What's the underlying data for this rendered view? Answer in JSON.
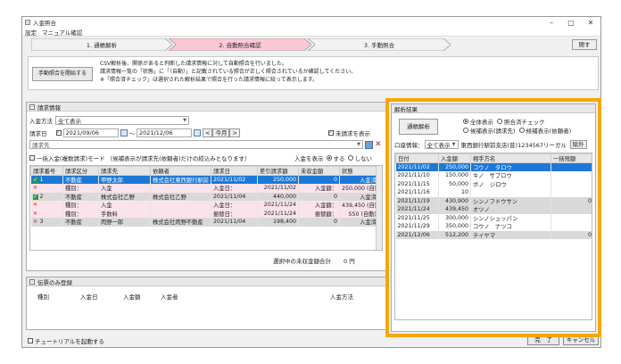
{
  "window": {
    "title": "入金照合",
    "controls": [
      "–",
      "▢",
      "✕"
    ]
  },
  "menu": [
    "設定",
    "マニュアル確認"
  ],
  "steps": [
    {
      "label": "1. 通帳解析",
      "color": "#f2f2f2"
    },
    {
      "label": "2. 自動照合確認",
      "color": "#f9c9d6"
    },
    {
      "label": "3. 手動照合",
      "color": "#f2f2f2"
    }
  ],
  "back_button": "閉す",
  "info": {
    "start_button": "手動照合を開始する",
    "lines": [
      "CSV解析後、関係があると判断した請求情報に対して自動照合を行いました。",
      "請求情報一覧の「状態」に「（自動）」と記載されている照合が正しく照合されているか確認してください。",
      "※「照合済チェック」は選択された解析結果で照合を行った請求情報に絞って表示します。"
    ]
  },
  "billing": {
    "header": "請求情報",
    "method_label": "入金方法",
    "method_value": "全て表示",
    "date_label": "請求日",
    "date_from": "2021/09/06",
    "date_to": "2021/12/06",
    "prev_btn": "<",
    "month_btn": "今月",
    "next_btn": ">",
    "unbilled_label": "未請求を表示",
    "client_placeholder": "請求先",
    "bulk_label": "一括入金(複数請求)モード （候補表示が請求先(依頼者)だけの絞込みとなります）",
    "show_paid_label": "入金を表示",
    "show_yes": "する",
    "show_no": "しない",
    "columns": [
      "請求番号",
      "請求区分",
      "請求先",
      "依頼者",
      "請求日",
      "差引請求額",
      "未収金額",
      "状態"
    ],
    "rows": [
      {
        "mark": "ok",
        "cells": [
          "1",
          "不動産",
          "甲野太郎",
          "株式会社東西銀行駅前",
          "2021/11/02",
          "250,000",
          "0",
          "入金済"
        ],
        "style": "hl"
      },
      {
        "mark": "x",
        "cells": [
          "",
          "種別：",
          "入金",
          "",
          "入金日：",
          "2021/11/02",
          "入金額：",
          "250,000 (自動)"
        ],
        "style": "pink"
      },
      {
        "mark": "ok",
        "cells": [
          "2",
          "不動産",
          "株式会社乙野",
          "株式会社乙野",
          "2021/11/04",
          "440,000",
          "0",
          "入金済"
        ],
        "style": "grey"
      },
      {
        "mark": "x",
        "cells": [
          "",
          "種別：",
          "入金",
          "",
          "入金日：",
          "2021/11/24",
          "入金額：",
          "439,450 (自動)"
        ],
        "style": "pink"
      },
      {
        "mark": "x",
        "cells": [
          "",
          "種別：",
          "手数料",
          "",
          "振替日：",
          "2021/11/24",
          "振替額：",
          "550 (自動)"
        ],
        "style": "pink"
      },
      {
        "mark": "x",
        "cells": [
          "3",
          "不動産",
          "丙野一郎",
          "株式会社丙野不動産",
          "2021/11/04",
          "198,400",
          "0",
          "入金済"
        ],
        "style": "grey"
      }
    ],
    "total_label": "選択中の未収金額合計",
    "total_value": "0 円"
  },
  "slip": {
    "header": "伝票のみ登録",
    "columns": [
      "種別",
      "入金日",
      "入金額",
      "入金者",
      "入金方法"
    ]
  },
  "results": {
    "header": "解析結果",
    "analyze_button": "通帳解析",
    "radio_all": "全体表示",
    "radio_matched": "照合済チェック",
    "radio_cand_client": "候補表示(請求先)",
    "radio_cand_requester": "候補表示(依頼者)",
    "account_label": "口座情報：",
    "account_value": "全て表示",
    "bank_value": "東西銀行駅前支店(普)1234567リーガル",
    "exclude_button": "除外",
    "columns": [
      "日付",
      "入金額",
      "相手方名",
      "一括残額"
    ],
    "rows": [
      {
        "date": "2021/11/02",
        "amount": "250,000",
        "name": "コウノ　タロウ",
        "rest": "",
        "style": "hl"
      },
      {
        "date": "2021/11/10",
        "amount": "150,000",
        "name": "キノ　サブロウ",
        "rest": "",
        "style": ""
      },
      {
        "date": "2021/11/15",
        "amount": "50,000",
        "name": "ボノ　ジロウ",
        "rest": "",
        "style": ""
      },
      {
        "date": "2021/11/16",
        "amount": "10",
        "name": "",
        "rest": "",
        "style": ""
      },
      {
        "date": "2021/11/19",
        "amount": "430,900",
        "name": "シンノフドウサン",
        "rest": "0",
        "style": "grey"
      },
      {
        "date": "2021/11/24",
        "amount": "439,450",
        "name": "オツノ",
        "rest": "",
        "style": "grey"
      },
      {
        "date": "2021/11/25",
        "amount": "300,000",
        "name": "シンノシュッパン",
        "rest": "",
        "style": ""
      },
      {
        "date": "2021/11/29",
        "amount": "350,000",
        "name": "コウノ　ナツコ",
        "rest": "",
        "style": ""
      },
      {
        "date": "2021/12/06",
        "amount": "512,200",
        "name": "テイヤマ",
        "rest": "0",
        "style": "grey"
      }
    ]
  },
  "footer": {
    "tutorial_label": "チュートリアルを起動する",
    "done_button": "完　了",
    "cancel_button": "キャンセル"
  },
  "colors": {
    "accent_blue": "#1e78d6",
    "highlight_border": "#f7a800",
    "pink": "#f9c9d6"
  }
}
